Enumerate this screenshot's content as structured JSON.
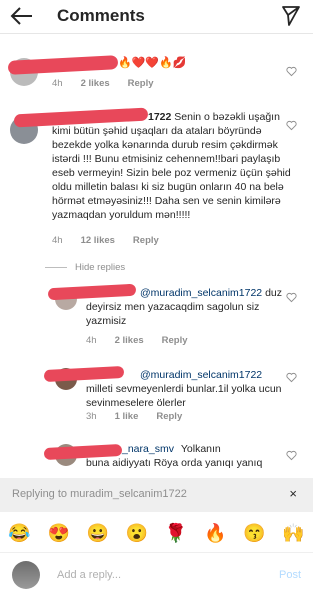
{
  "header": {
    "title": "Comments"
  },
  "comments": [
    {
      "emojis": "🔥❤️❤️🔥💋",
      "time": "4h",
      "likes": "2 likes",
      "reply": "Reply"
    },
    {
      "handle_tail": "1722",
      "text": "Senin o bəzəkli uşağın kimi bütün şəhid uşaqları da ataları böyründə bezekde yolka kənarında durub resim çəkdirmək istərdi !!! Bunu etmisiniz cehennem!!bari paylaşıb eseb vermeyin! Sizin bele poz vermeniz üçün şəhid oldu milletin balası ki siz bugün onların 40 na belə hörmət etməyəsiniz!!! Daha sen ve senin kimilərə yazmaqdan yoruldum mən!!!!!",
      "time": "4h",
      "likes": "12 likes",
      "reply": "Reply"
    }
  ],
  "hide_replies": "Hide replies",
  "replies": [
    {
      "mention": "@muradim_selcanim1722",
      "text": "duz deyirsiz men yazacaqdim sagolun siz yazmisiz",
      "time": "4h",
      "likes": "2 likes",
      "reply": "Reply"
    },
    {
      "mention": "@muradim_selcanim1722",
      "text": "milleti sevmeyenlerdi bunlar.1il yolka ucun sevinmeselere ölerler",
      "time": "3h",
      "likes": "1 like",
      "reply": "Reply"
    },
    {
      "mention": "_nara_smv",
      "text_tail": "Yolkanın",
      "text": "buna aidiyyatı Röya orda yanıqı yanıq",
      "time": "",
      "likes": "",
      "reply": ""
    }
  ],
  "replying": {
    "label": "Replying to muradim_selcanim1722",
    "close": "×"
  },
  "emoji_bar": [
    "😂",
    "😍",
    "😀",
    "😮",
    "🌹",
    "🔥",
    "😙",
    "🙌"
  ],
  "composer": {
    "placeholder": "Add a reply...",
    "post": "Post"
  }
}
